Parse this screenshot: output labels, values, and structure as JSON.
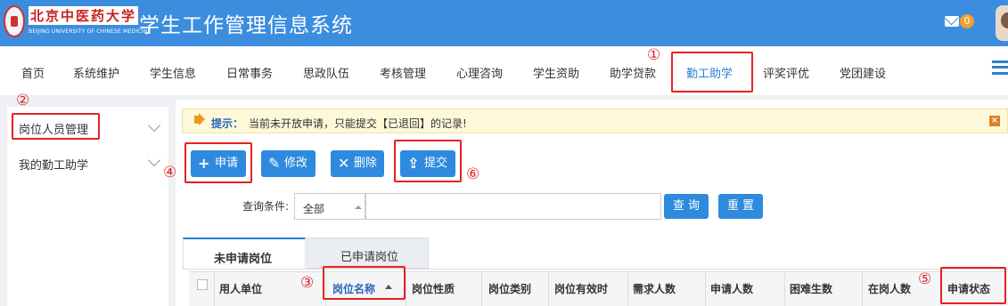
{
  "header": {
    "school_logo_text": "北京中医药大学",
    "school_logo_sub": "BEIJING UNIVERSITY OF CHINESE MEDICINE",
    "title": "学生工作管理信息系统",
    "mail_count": "0"
  },
  "nav": {
    "items": [
      "首页",
      "系统维护",
      "学生信息",
      "日常事务",
      "思政队伍",
      "考核管理",
      "心理咨询",
      "学生资助",
      "助学贷款",
      "勤工助学",
      "评奖评优",
      "党团建设"
    ],
    "active": "勤工助学"
  },
  "sidebar": {
    "items": [
      {
        "label": "岗位人员管理"
      },
      {
        "label": "我的勤工助学"
      }
    ]
  },
  "notice": {
    "label": "提示：",
    "text": "当前未开放申请，只能提交【已退回】的记录!",
    "close": "×"
  },
  "toolbar": {
    "apply": "申请",
    "edit": "修改",
    "delete": "删除",
    "submit": "提交"
  },
  "query": {
    "label": "查询条件:",
    "select_value": "全部",
    "input_value": "",
    "search": "查 询",
    "reset": "重 置"
  },
  "tabs": [
    "未申请岗位",
    "已申请岗位"
  ],
  "table": {
    "columns": [
      "用人单位",
      "岗位名称",
      "岗位性质",
      "岗位类别",
      "岗位有效时",
      "需求人数",
      "申请人数",
      "困难生数",
      "在岗人数",
      "申请状态"
    ]
  },
  "annotations": [
    "①",
    "②",
    "③",
    "④",
    "⑤",
    "⑥"
  ],
  "colors": {
    "brand": "#3c8dde",
    "button": "#2e8ade",
    "highlight": "#e52222"
  }
}
